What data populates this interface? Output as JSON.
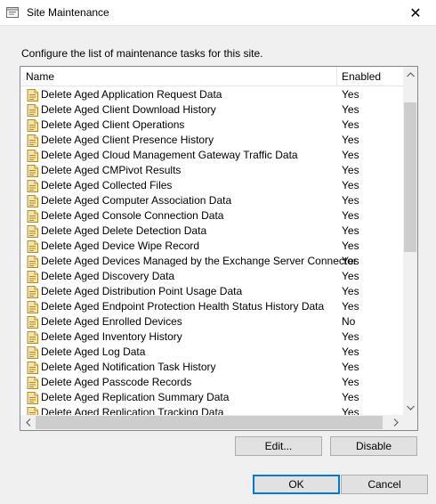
{
  "window": {
    "title": "Site Maintenance",
    "close_glyph": "✕"
  },
  "description": "Configure the list of maintenance tasks for this site.",
  "list": {
    "columns": {
      "name": "Name",
      "enabled": "Enabled"
    },
    "rows": [
      {
        "name": "Delete Aged Application Request Data",
        "enabled": "Yes"
      },
      {
        "name": "Delete Aged Client Download History",
        "enabled": "Yes"
      },
      {
        "name": "Delete Aged Client Operations",
        "enabled": "Yes"
      },
      {
        "name": "Delete Aged Client Presence History",
        "enabled": "Yes"
      },
      {
        "name": "Delete Aged Cloud Management Gateway Traffic Data",
        "enabled": "Yes"
      },
      {
        "name": "Delete Aged CMPivot Results",
        "enabled": "Yes"
      },
      {
        "name": "Delete Aged Collected Files",
        "enabled": "Yes"
      },
      {
        "name": "Delete Aged Computer Association Data",
        "enabled": "Yes"
      },
      {
        "name": "Delete Aged Console Connection Data",
        "enabled": "Yes"
      },
      {
        "name": "Delete Aged Delete Detection Data",
        "enabled": "Yes"
      },
      {
        "name": "Delete Aged Device Wipe Record",
        "enabled": "Yes"
      },
      {
        "name": "Delete Aged Devices Managed by the Exchange Server Connector",
        "enabled": "Yes"
      },
      {
        "name": "Delete Aged Discovery Data",
        "enabled": "Yes"
      },
      {
        "name": "Delete Aged Distribution Point Usage Data",
        "enabled": "Yes"
      },
      {
        "name": "Delete Aged Endpoint Protection Health Status History Data",
        "enabled": "Yes"
      },
      {
        "name": "Delete Aged Enrolled Devices",
        "enabled": "No"
      },
      {
        "name": "Delete Aged Inventory History",
        "enabled": "Yes"
      },
      {
        "name": "Delete Aged Log Data",
        "enabled": "Yes"
      },
      {
        "name": "Delete Aged Notification Task History",
        "enabled": "Yes"
      },
      {
        "name": "Delete Aged Passcode Records",
        "enabled": "Yes"
      },
      {
        "name": "Delete Aged Replication Summary Data",
        "enabled": "Yes"
      },
      {
        "name": "Delete Aged Replication Tracking Data",
        "enabled": "Yes"
      }
    ],
    "row_icon": "task-icon"
  },
  "buttons": {
    "edit": "Edit...",
    "disable": "Disable",
    "ok": "OK",
    "cancel": "Cancel"
  }
}
